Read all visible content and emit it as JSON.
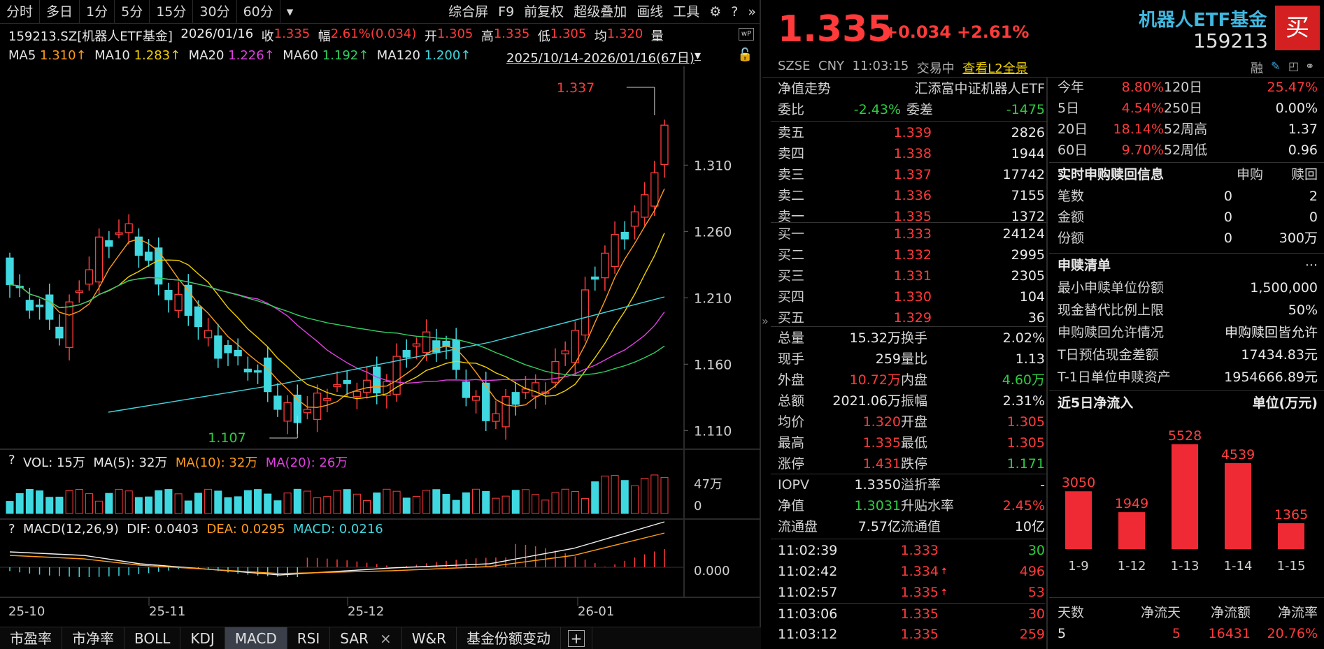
{
  "topbar": {
    "tabs": [
      "分时",
      "多日",
      "1分",
      "5分",
      "15分",
      "30分",
      "60分"
    ],
    "more": "▾",
    "right": [
      "综合屏",
      "F9",
      "前复权",
      "超级叠加",
      "画线",
      "工具"
    ]
  },
  "info": {
    "code": "159213.SZ[机器人ETF基金]",
    "date": "2026/01/16",
    "close_l": "收",
    "close": "1.335",
    "chg_l": "幅",
    "chg": "2.61%(0.034)",
    "open_l": "开",
    "open": "1.305",
    "high_l": "高",
    "high": "1.335",
    "low_l": "低",
    "low": "1.305",
    "avg_l": "均",
    "avg": "1.320",
    "vol_l": "量"
  },
  "ma": {
    "ma5": "MA5",
    "ma5v": "1.310↑",
    "ma10": "MA10",
    "ma10v": "1.283↑",
    "ma20": "MA20",
    "ma20v": "1.226↑",
    "ma60": "MA60",
    "ma60v": "1.192↑",
    "ma120": "MA120",
    "ma120v": "1.200↑",
    "range": "2025/10/14-2026/01/16(67日)",
    "dd": "▾"
  },
  "price_axis": [
    "1.310",
    "1.260",
    "1.210",
    "1.160",
    "1.110"
  ],
  "annotations": {
    "high": "1.337",
    "low": "1.107"
  },
  "vol": {
    "q": "?",
    "label": "VOL: 15万",
    "ma5": "MA(5): 32万",
    "ma10": "MA(10): 32万",
    "ma20": "MA(20): 26万",
    "axis_top": "47万",
    "axis_zero": "0"
  },
  "macd": {
    "q": "?",
    "label": "MACD(12,26,9)",
    "dif": "DIF: 0.0403",
    "dea": "DEA: 0.0295",
    "macd": "MACD: 0.0216",
    "axis_zero": "0.000"
  },
  "x_axis": [
    "25-10",
    "25-11",
    "25-12",
    "26-01"
  ],
  "bottom_tabs": [
    "市盈率",
    "市净率",
    "BOLL",
    "KDJ",
    "MACD",
    "RSI",
    "SAR",
    "W&R",
    "基金份额变动"
  ],
  "bottom_close": "×",
  "bottom_add": "+",
  "quote": {
    "price": "1.335",
    "chg": "+0.034",
    "pct": "+2.61%",
    "name": "机器人ETF基金",
    "code": "159213",
    "buy": "买",
    "exchange": "SZSE",
    "currency": "CNY",
    "time": "11:03:15",
    "status": "交易中",
    "l2": "查看L2全景",
    "rong": "融"
  },
  "colors": {
    "up": "#ff3a3a",
    "down": "#2ecc40",
    "cyan": "#40d8e0",
    "accent": "#f02a34"
  },
  "netval": {
    "label": "净值走势",
    "fund": "汇添富中证机器人ETF"
  },
  "wb": {
    "wb_l": "委比",
    "wb": "-2.43%",
    "wc_l": "委差",
    "wc": "-1475"
  },
  "asks": [
    {
      "l": "卖五",
      "p": "1.339",
      "v": "2826"
    },
    {
      "l": "卖四",
      "p": "1.338",
      "v": "1944"
    },
    {
      "l": "卖三",
      "p": "1.337",
      "v": "17742"
    },
    {
      "l": "卖二",
      "p": "1.336",
      "v": "7155"
    },
    {
      "l": "卖一",
      "p": "1.335",
      "v": "1372"
    }
  ],
  "bids": [
    {
      "l": "买一",
      "p": "1.333",
      "v": "24124"
    },
    {
      "l": "买二",
      "p": "1.332",
      "v": "2995"
    },
    {
      "l": "买三",
      "p": "1.331",
      "v": "2305"
    },
    {
      "l": "买四",
      "p": "1.330",
      "v": "104"
    },
    {
      "l": "买五",
      "p": "1.329",
      "v": "36"
    }
  ],
  "stats": [
    [
      "总量",
      "15.32万",
      "换手",
      "2.02%"
    ],
    [
      "现手",
      "259",
      "量比",
      "1.13"
    ],
    [
      "外盘",
      "10.72万",
      "内盘",
      "4.60万"
    ],
    [
      "总额",
      "2021.06万",
      "振幅",
      "2.31%"
    ],
    [
      "均价",
      "1.320",
      "开盘",
      "1.305"
    ],
    [
      "最高",
      "1.335",
      "最低",
      "1.305"
    ],
    [
      "涨停",
      "1.431",
      "跌停",
      "1.171"
    ]
  ],
  "stats2": [
    [
      "IOPV",
      "1.3350",
      "溢折率",
      "-"
    ],
    [
      "净值",
      "1.3031",
      "升贴水率",
      "2.45%"
    ],
    [
      "流通盘",
      "7.57亿",
      "流通值",
      "10亿"
    ]
  ],
  "ticks": [
    {
      "t": "11:02:39",
      "p": "1.333",
      "a": "",
      "v": "30"
    },
    {
      "t": "11:02:42",
      "p": "1.334",
      "a": "🠅",
      "v": "496"
    },
    {
      "t": "11:02:57",
      "p": "1.335",
      "a": "🠅",
      "v": "53"
    },
    {
      "t": "11:03:06",
      "p": "1.335",
      "a": "",
      "v": "30"
    },
    {
      "t": "11:03:12",
      "p": "1.335",
      "a": "",
      "v": "259"
    }
  ],
  "perf": [
    [
      "今年",
      "8.80%",
      "120日",
      "25.47%"
    ],
    [
      "5日",
      "4.54%",
      "250日",
      "0.00%"
    ],
    [
      "20日",
      "18.14%",
      "52周高",
      "1.37"
    ],
    [
      "60日",
      "9.70%",
      "52周低",
      "0.96"
    ]
  ],
  "subs": {
    "title": "实时申购赎回信息",
    "h1": "申购",
    "h2": "赎回",
    "rows": [
      [
        "笔数",
        "0",
        "2"
      ],
      [
        "金额",
        "0",
        "0"
      ],
      [
        "份额",
        "0",
        "300万"
      ]
    ]
  },
  "list": {
    "title": "申赎清单",
    "more": "···",
    "rows": [
      [
        "最小申赎单位份额",
        "1,500,000"
      ],
      [
        "现金替代比例上限",
        "50%"
      ],
      [
        "申购赎回允许情况",
        "申购赎回皆允许"
      ],
      [
        "T日预估现金差额",
        "17434.83元"
      ],
      [
        "T-1日单位申赎资产",
        "1954666.89元"
      ]
    ]
  },
  "flow": {
    "title": "近5日净流入",
    "unit": "单位(万元)",
    "days": [
      "1-9",
      "1-12",
      "1-13",
      "1-14",
      "1-15"
    ],
    "values": [
      3050,
      1949,
      5528,
      4539,
      1365
    ],
    "labels": [
      "3050",
      "1949",
      "5528",
      "4539",
      "1365"
    ]
  },
  "summary": {
    "h": [
      "天数",
      "净流天",
      "净流额",
      "净流率"
    ],
    "v": [
      "5",
      "5",
      "16431",
      "20.76%"
    ]
  }
}
